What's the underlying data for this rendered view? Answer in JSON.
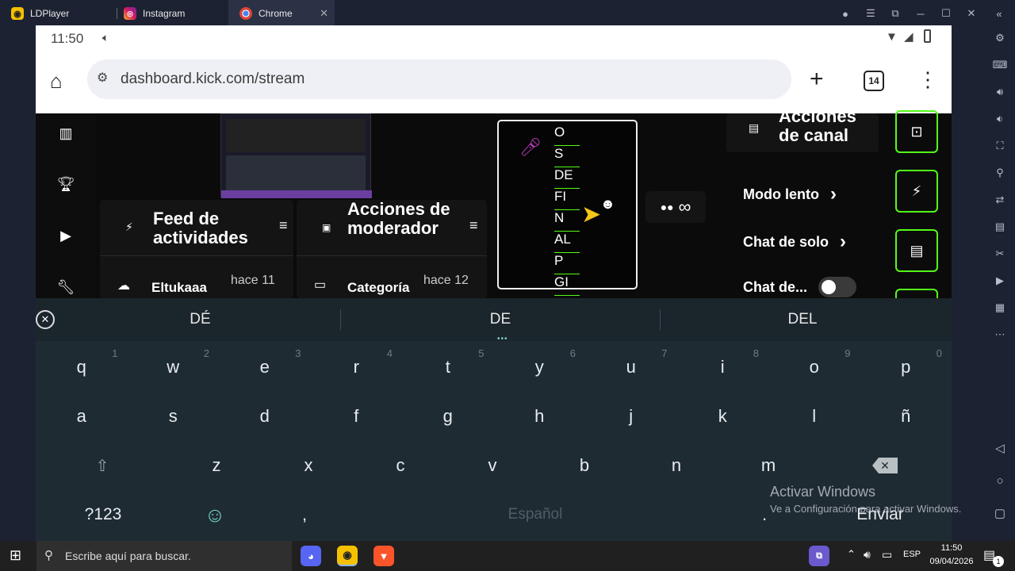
{
  "tabs": [
    {
      "label": "LDPlayer",
      "icon": "ldplayer-icon"
    },
    {
      "label": "Instagram",
      "icon": "instagram-icon"
    },
    {
      "label": "Chrome",
      "icon": "chrome-icon"
    }
  ],
  "phone": {
    "status": {
      "time": "11:50"
    },
    "url": "dashboard.kick.com/stream",
    "tab_count": "14"
  },
  "panels": {
    "feed": {
      "title": "Feed de actividades",
      "item_user": "Eltukaaa",
      "item_time": "hace 11"
    },
    "mod": {
      "title": "Acciones de moderador",
      "item_label": "Categoría",
      "item_time": "hace 12"
    },
    "channel": {
      "title": "Acciones de canal",
      "items": [
        "Modo lento",
        "Chat de solo",
        "Chat de..."
      ]
    }
  },
  "overlay_words": [
    "O",
    "S",
    "DE",
    "FI",
    "N",
    "AL",
    "P",
    "GI"
  ],
  "infinity_label": "∞",
  "keyboard": {
    "suggestions": [
      "DÉ",
      "DE",
      "DEL"
    ],
    "row1": [
      {
        "k": "q",
        "h": "1"
      },
      {
        "k": "w",
        "h": "2"
      },
      {
        "k": "e",
        "h": "3"
      },
      {
        "k": "r",
        "h": "4"
      },
      {
        "k": "t",
        "h": "5"
      },
      {
        "k": "y",
        "h": "6"
      },
      {
        "k": "u",
        "h": "7"
      },
      {
        "k": "i",
        "h": "8"
      },
      {
        "k": "o",
        "h": "9"
      },
      {
        "k": "p",
        "h": "0"
      }
    ],
    "row2": [
      "a",
      "s",
      "d",
      "f",
      "g",
      "h",
      "j",
      "k",
      "l",
      "ñ"
    ],
    "row3": [
      "z",
      "x",
      "c",
      "v",
      "b",
      "n",
      "m"
    ],
    "symbols": "?123",
    "comma": ",",
    "space": "Español",
    "period": ".",
    "enter": "Enviar"
  },
  "watermark": {
    "title": "Activar Windows",
    "subtitle": "Ve a Configuración para activar Windows."
  },
  "taskbar": {
    "search_placeholder": "Escribe aquí para buscar.",
    "lang": "ESP",
    "time": "11:50",
    "date": "09/04/2026",
    "notif_count": "1"
  },
  "colors": {
    "kick_green": "#53fc18",
    "keyboard_bg": "#1f2b33",
    "titlebar_bg": "#1d2233"
  }
}
